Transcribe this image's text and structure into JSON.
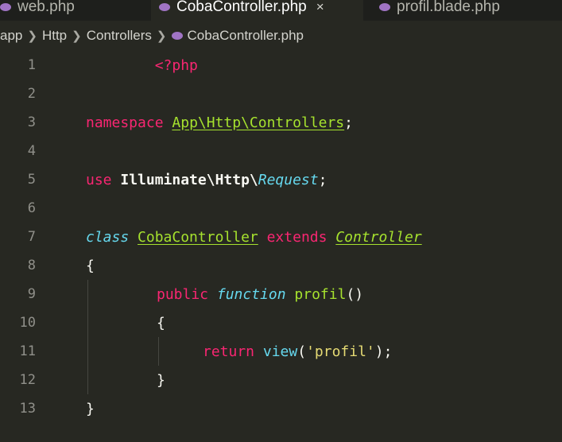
{
  "tabs": [
    {
      "label": "web.php",
      "active": false
    },
    {
      "label": "CobaController.php",
      "active": true,
      "close": "×"
    },
    {
      "label": "profil.blade.php",
      "active": false
    }
  ],
  "breadcrumb": [
    "app",
    "Http",
    "Controllers",
    "CobaController.php"
  ],
  "editor": {
    "line_numbers": [
      "1",
      "2",
      "3",
      "4",
      "5",
      "6",
      "7",
      "8",
      "9",
      "10",
      "11",
      "12",
      "13"
    ],
    "line1": {
      "open_tag": "<?php"
    },
    "line3": {
      "keyword": "namespace",
      "namespace": "App\\Http\\Controllers",
      "end": ";"
    },
    "line5": {
      "keyword": "use",
      "path": "Illuminate\\Http\\",
      "class": "Request",
      "end": ";"
    },
    "line7": {
      "keyword": "class",
      "name": "CobaController",
      "extends": "extends",
      "parent": "Controller"
    },
    "line8": {
      "brace": "{"
    },
    "line9": {
      "visibility": "public",
      "function_kw": "function",
      "name": "profil",
      "parens": "()"
    },
    "line10": {
      "brace": "{"
    },
    "line11": {
      "keyword": "return",
      "call": "view",
      "open": "(",
      "string": "'profil'",
      "close": ");"
    },
    "line12": {
      "brace": "}"
    },
    "line13": {
      "brace": "}"
    }
  },
  "colors": {
    "background": "#272822",
    "keyword": "#f92672",
    "entity": "#a6e22e",
    "builtin": "#66d9ef",
    "string": "#e6db74",
    "line_number": "#90908a"
  }
}
